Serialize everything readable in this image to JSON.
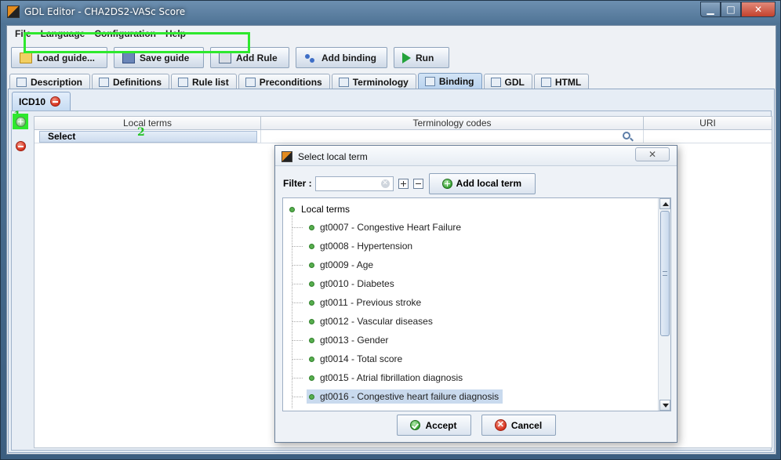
{
  "window": {
    "title": "GDL Editor - CHA2DS2-VASc Score",
    "controls": {
      "minimize": "▁",
      "maximize": "□",
      "close": "✕"
    }
  },
  "menu": [
    "File",
    "Language",
    "Configuration",
    "Help"
  ],
  "toolbar": {
    "load_guide": "Load guide...",
    "save_guide": "Save guide",
    "add_rule": "Add Rule",
    "add_binding": "Add binding",
    "run": "Run"
  },
  "tabs": [
    {
      "label": "Description",
      "icon": "description-icon"
    },
    {
      "label": "Definitions",
      "icon": "definitions-icon"
    },
    {
      "label": "Rule list",
      "icon": "rule-list-icon"
    },
    {
      "label": "Preconditions",
      "icon": "preconditions-icon"
    },
    {
      "label": "Terminology",
      "icon": "terminology-icon"
    },
    {
      "label": "Binding",
      "icon": "binding-icon",
      "active": true
    },
    {
      "label": "GDL",
      "icon": "gdl-icon"
    },
    {
      "label": "HTML",
      "icon": "html-icon"
    }
  ],
  "binding": {
    "subtab_label": "ICD10",
    "table": {
      "headers": [
        "Local terms",
        "Terminology codes",
        "URI"
      ],
      "row": {
        "local_term": "Select",
        "terminology_codes": "",
        "uri": ""
      }
    },
    "annotations": {
      "first": "1",
      "second": "2"
    }
  },
  "dialog": {
    "title": "Select local term",
    "close_label": "✕",
    "filter_label": "Filter :",
    "filter_value": "",
    "add_local_term": "Add local term",
    "tree_root": "Local terms",
    "items": [
      "gt0007 - Congestive Heart Failure",
      "gt0008 - Hypertension",
      "gt0009 - Age",
      "gt0010 - Diabetes",
      "gt0011 - Previous stroke",
      "gt0012 - Vascular diseases",
      "gt0013 - Gender",
      "gt0014 - Total score",
      "gt0015 - Atrial fibrillation diagnosis",
      "gt0016 - Congestive heart failure diagnosis"
    ],
    "selected_index": 9,
    "accept": "Accept",
    "cancel": "Cancel"
  },
  "colors": {
    "highlight_green": "#2ee82e",
    "selection_blue": "#c9daee",
    "active_tab": "#b8d2ee"
  }
}
